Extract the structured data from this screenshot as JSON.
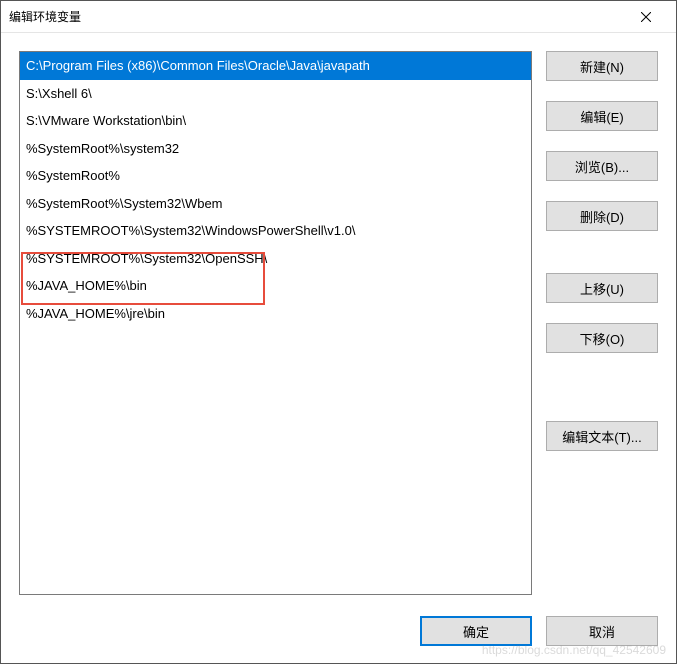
{
  "titlebar": {
    "title": "编辑环境变量"
  },
  "list": {
    "items": [
      "C:\\Program Files (x86)\\Common Files\\Oracle\\Java\\javapath",
      "S:\\Xshell 6\\",
      "S:\\VMware Workstation\\bin\\",
      "%SystemRoot%\\system32",
      "%SystemRoot%",
      "%SystemRoot%\\System32\\Wbem",
      "%SYSTEMROOT%\\System32\\WindowsPowerShell\\v1.0\\",
      "%SYSTEMROOT%\\System32\\OpenSSH\\",
      "%JAVA_HOME%\\bin",
      "%JAVA_HOME%\\jre\\bin"
    ],
    "selected_index": 0
  },
  "buttons": {
    "new": "新建(N)",
    "edit": "编辑(E)",
    "browse": "浏览(B)...",
    "delete": "删除(D)",
    "moveup": "上移(U)",
    "movedown": "下移(O)",
    "edittext": "编辑文本(T)...",
    "ok": "确定",
    "cancel": "取消"
  },
  "watermark": "https://blog.csdn.net/qq_42542609"
}
